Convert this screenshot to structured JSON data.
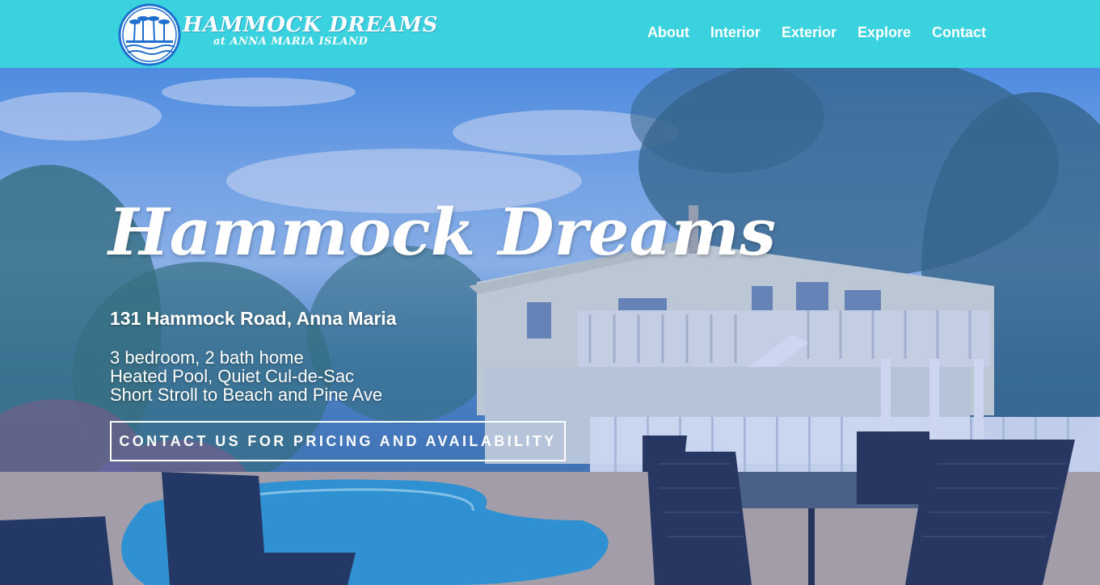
{
  "brand": {
    "title": "HAMMOCK DREAMS",
    "subtitle": "at ANNA MARIA ISLAND",
    "logo_icon": "palm-trees-badge-icon"
  },
  "nav": {
    "items": [
      {
        "label": "About"
      },
      {
        "label": "Interior"
      },
      {
        "label": "Exterior"
      },
      {
        "label": "Explore"
      },
      {
        "label": "Contact"
      }
    ]
  },
  "hero": {
    "title": "Hammock Dreams",
    "address": "131 Hammock Road, Anna Maria",
    "details": [
      "3 bedroom, 2 bath home",
      "Heated Pool, Quiet Cul-de-Sac",
      "Short Stroll to Beach and Pine Ave"
    ],
    "cta_label": "CONTACT US FOR PRICING AND AVAILABILITY"
  },
  "colors": {
    "header_bg": "#3ad2de",
    "logo_blue": "#1f6fd0",
    "text": "#ffffff"
  }
}
